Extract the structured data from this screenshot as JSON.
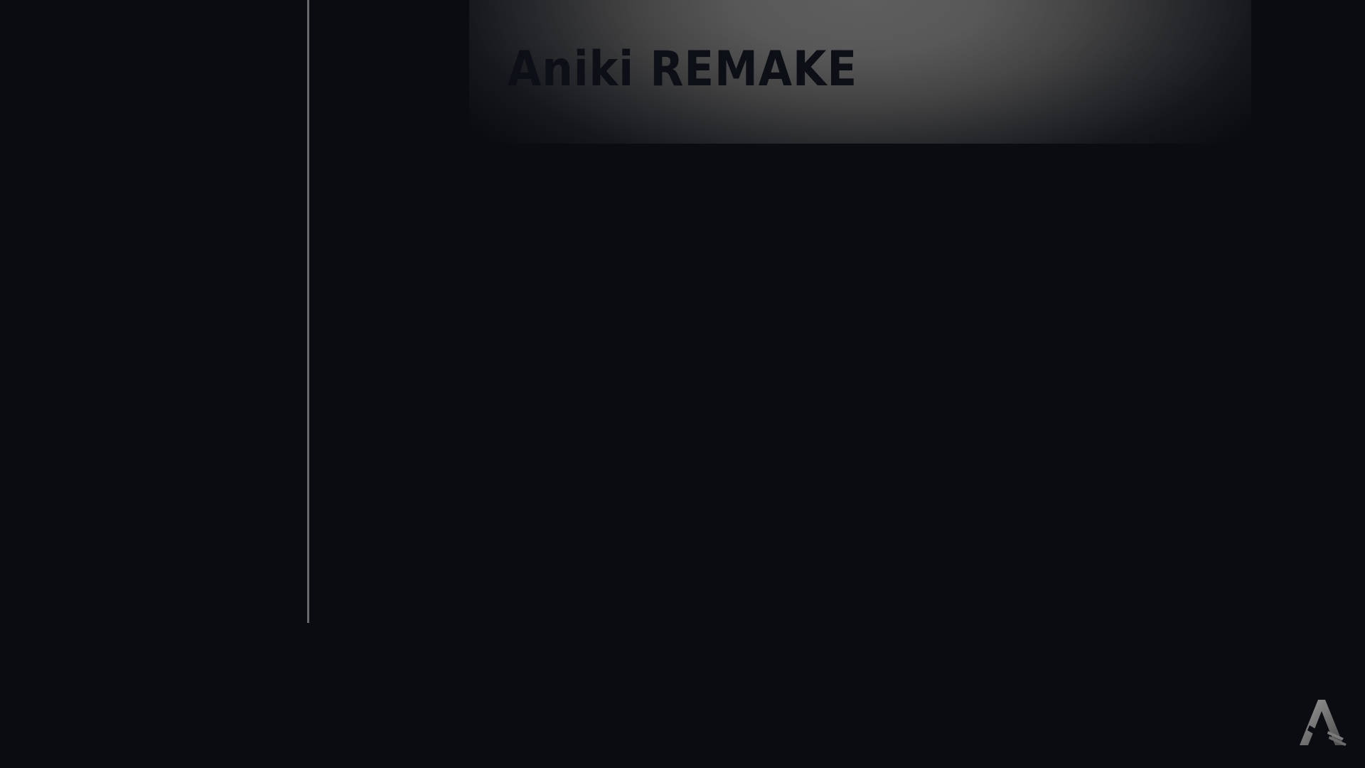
{
  "app": {
    "title": "Aniki REMAKE"
  },
  "icons": {
    "logo": "aniki-a-logo-icon"
  },
  "colors": {
    "background": "#0a0c12",
    "banner_highlight": "#5e5e5e",
    "divider": "#6a6a6a",
    "title_text": "#0d0f16"
  }
}
